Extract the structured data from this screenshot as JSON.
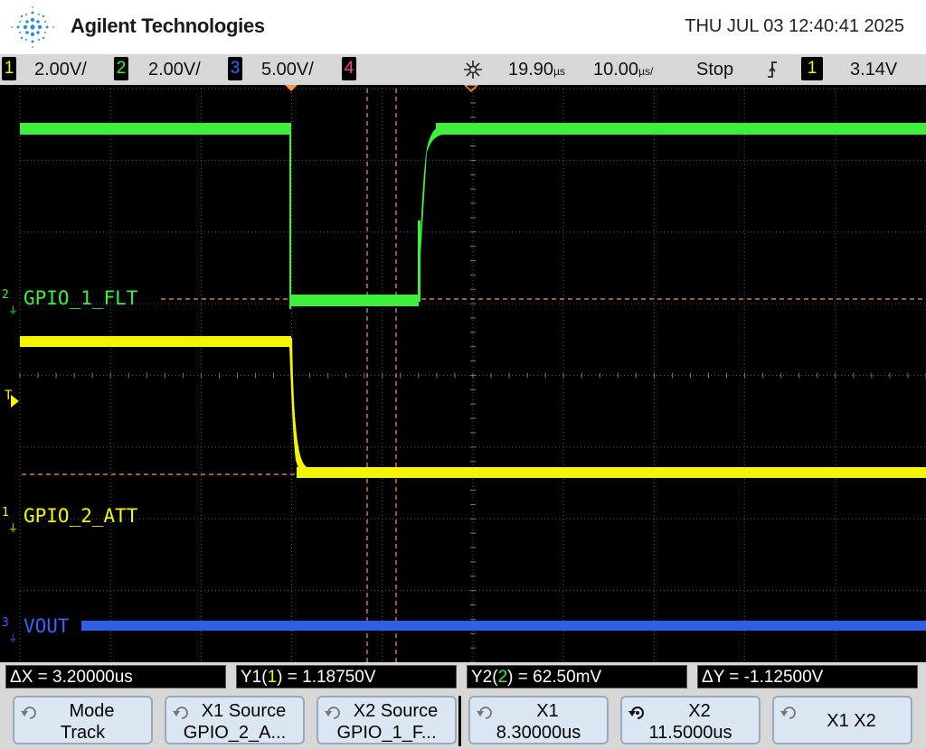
{
  "header": {
    "brand": "Agilent Technologies",
    "datetime": "THU JUL 03 12:40:41 2025"
  },
  "status": {
    "ch1": {
      "num": "1",
      "scale": "2.00V/",
      "color": "#f5f500"
    },
    "ch2": {
      "num": "2",
      "scale": "2.00V/",
      "color": "#3cf03c"
    },
    "ch3": {
      "num": "3",
      "scale": "5.00V/",
      "color": "#3366ff"
    },
    "ch4": {
      "num": "4",
      "color": "#ff3d8c"
    },
    "delay": "19.90",
    "delay_unit": "µs",
    "timebase": "10.00",
    "timebase_unit": "µs/",
    "run_state": "Stop",
    "trigger_source": "1",
    "trigger_level": "3.14V"
  },
  "waveform_labels": {
    "ch2_num": "2",
    "ch2": "GPIO_1_FLT",
    "ch1_num": "1",
    "ch1": "GPIO_2_ATT",
    "ch3_num": "3",
    "ch3": "VOUT",
    "trigger_marker": "T"
  },
  "measurements": {
    "dx": "ΔX = 3.20000us",
    "y1_prefix": "Y1(",
    "y1_ch": "1",
    "y1_suffix": ") = 1.18750V",
    "y2_prefix": "Y2(",
    "y2_ch": "2",
    "y2_suffix": ") = 62.50mV",
    "dy": "ΔY = -1.12500V"
  },
  "softkeys": [
    {
      "line1": "Mode",
      "line2": "Track"
    },
    {
      "line1": "X1 Source",
      "line2": "GPIO_2_A..."
    },
    {
      "line1": "X2 Source",
      "line2": "GPIO_1_F..."
    },
    {
      "line1": "X1",
      "line2": "8.30000us"
    },
    {
      "line1": "X2",
      "line2": "11.5000us"
    },
    {
      "line1": "X1 X2",
      "line2": ""
    }
  ],
  "colors": {
    "ch1": "#f5f500",
    "ch2": "#3cf03c",
    "ch3": "#2f5fe6",
    "cursor": "#ff9a3c",
    "grid": "#5a5a5a"
  }
}
